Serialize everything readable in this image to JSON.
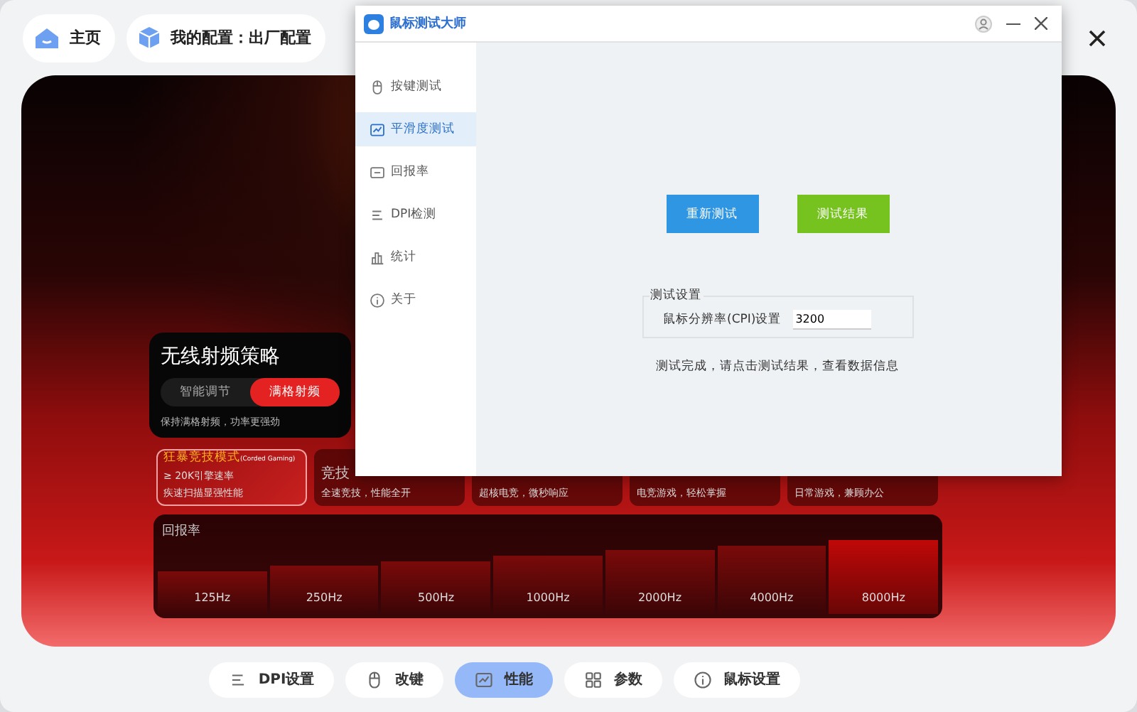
{
  "top_bar": {
    "home": "主页",
    "config": "我的配置：出厂配置"
  },
  "wireless": {
    "title": "无线射频策略",
    "options": [
      {
        "label": "智能调节",
        "selected": false
      },
      {
        "label": "满格射频",
        "selected": true
      }
    ],
    "note": "保持满格射频，功率更强劲"
  },
  "modes": [
    {
      "title": "狂暴竞技模式",
      "tag": "(Corded Gaming)",
      "lines": [
        "≥ 20K引擎速率",
        "疾速扫描显强性能"
      ],
      "selected": true
    },
    {
      "title": "竞技",
      "lines": [
        "全速竞技，性能全开"
      ],
      "selected": false
    },
    {
      "lines": [
        "超核电竞，微秒响应"
      ],
      "selected": false
    },
    {
      "lines": [
        "电竞游戏，轻松掌握"
      ],
      "selected": false
    },
    {
      "lines": [
        "日常游戏，兼顾办公"
      ],
      "selected": false
    }
  ],
  "report_rate": {
    "title": "回报率",
    "rates": [
      {
        "label": "125Hz",
        "selected": false
      },
      {
        "label": "250Hz",
        "selected": false
      },
      {
        "label": "500Hz",
        "selected": false
      },
      {
        "label": "1000Hz",
        "selected": false
      },
      {
        "label": "2000Hz",
        "selected": false
      },
      {
        "label": "4000Hz",
        "selected": false
      },
      {
        "label": "8000Hz",
        "selected": true
      }
    ]
  },
  "bottom_nav": [
    {
      "label": "DPI设置",
      "selected": false
    },
    {
      "label": "改键",
      "selected": false
    },
    {
      "label": "性能",
      "selected": true
    },
    {
      "label": "参数",
      "selected": false
    },
    {
      "label": "鼠标设置",
      "selected": false
    }
  ],
  "window": {
    "title": "鼠标测试大师",
    "sidebar": [
      {
        "label": "按键测试",
        "selected": false
      },
      {
        "label": "平滑度测试",
        "selected": true
      },
      {
        "label": "回报率",
        "selected": false
      },
      {
        "label": "DPI检测",
        "selected": false
      },
      {
        "label": "统计",
        "selected": false
      },
      {
        "label": "关于",
        "selected": false
      }
    ],
    "buttons": [
      {
        "label": "重新测试",
        "kind": "primary"
      },
      {
        "label": "测试结果",
        "kind": "success"
      }
    ],
    "settings": {
      "title": "测试设置",
      "label": "鼠标分辨率(CPI)设置",
      "value": "3200"
    },
    "message": "测试完成，请点击测试结果，查看数据信息"
  }
}
